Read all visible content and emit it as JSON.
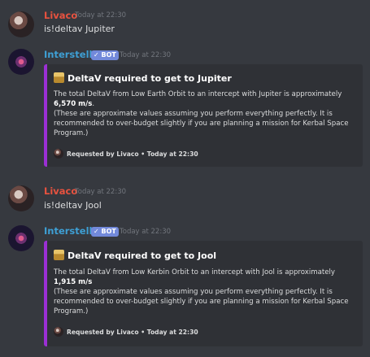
{
  "messages": [
    {
      "author": "Livaco",
      "time": "Today at 22:30",
      "content": "is!deltav Jupiter"
    },
    {
      "author": "Interstellar",
      "badge": "✓ BOT",
      "time": "Today at 22:30",
      "embed": {
        "title": "DeltaV required to get to Jupiter",
        "line1": "The total DeltaV from Low Earth Orbit to an intercept with Jupiter is approximately",
        "value": "6,570 m/s",
        "line3": "(These are approximate values assuming you perform everything perfectly. It is recommended to over-budget slightly if you are planning a mission for Kerbal Space Program.)",
        "footer": "Requested by Livaco • Today at 22:30",
        "accent": "#9b2fd4"
      }
    },
    {
      "author": "Livaco",
      "time": "Today at 22:30",
      "content": "is!deltav Jool"
    },
    {
      "author": "Interstellar",
      "badge": "✓ BOT",
      "time": "Today at 22:30",
      "embed": {
        "title": "DeltaV required to get to Jool",
        "line1": "The total DeltaV from Low Kerbin Orbit to an intercept with Jool is approximately",
        "value": "1,915 m/s",
        "line3": "(These are approximate values assuming you perform everything perfectly. It is recommended to over-budget slightly if you are planning a mission for Kerbal Space Program.)",
        "footer": "Requested by Livaco • Today at 22:30",
        "accent": "#9b2fd4"
      }
    }
  ],
  "colors": {
    "background": "#36393f",
    "embed_bg": "#2f3136",
    "user_name": "#e8523f",
    "bot_name": "#3e9fd4",
    "bot_badge": "#7289da"
  },
  "icons": {
    "user_avatar": "avatar-icon",
    "bot_avatar": "galaxy-avatar-icon",
    "embed_emoji": "fuel-pump-icon"
  }
}
